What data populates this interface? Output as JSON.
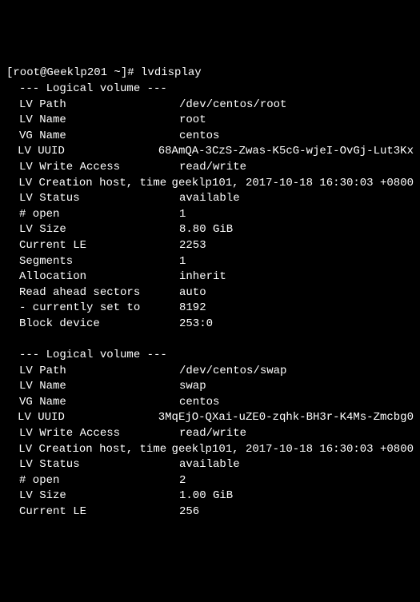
{
  "prompt": {
    "user_host": "[root@Geeklp201 ~]#",
    "command": "lvdisplay"
  },
  "volumes": [
    {
      "header": "--- Logical volume ---",
      "fields": [
        {
          "label": "LV Path",
          "value": "/dev/centos/root"
        },
        {
          "label": "LV Name",
          "value": "root"
        },
        {
          "label": "VG Name",
          "value": "centos"
        },
        {
          "label": "LV UUID",
          "value": "68AmQA-3CzS-Zwas-K5cG-wjeI-OvGj-Lut3Kx"
        },
        {
          "label": "LV Write Access",
          "value": "read/write"
        },
        {
          "label": "LV Creation host, time",
          "value": "geeklp101, 2017-10-18 16:30:03 +0800"
        },
        {
          "label": "LV Status",
          "value": "available"
        },
        {
          "label": "# open",
          "value": "1"
        },
        {
          "label": "LV Size",
          "value": "8.80 GiB"
        },
        {
          "label": "Current LE",
          "value": "2253"
        },
        {
          "label": "Segments",
          "value": "1"
        },
        {
          "label": "Allocation",
          "value": "inherit"
        },
        {
          "label": "Read ahead sectors",
          "value": "auto"
        },
        {
          "label": "- currently set to",
          "value": "8192"
        },
        {
          "label": "Block device",
          "value": "253:0"
        }
      ]
    },
    {
      "header": "--- Logical volume ---",
      "fields": [
        {
          "label": "LV Path",
          "value": "/dev/centos/swap"
        },
        {
          "label": "LV Name",
          "value": "swap"
        },
        {
          "label": "VG Name",
          "value": "centos"
        },
        {
          "label": "LV UUID",
          "value": "3MqEjO-QXai-uZE0-zqhk-BH3r-K4Ms-Zmcbg0"
        },
        {
          "label": "LV Write Access",
          "value": "read/write"
        },
        {
          "label": "LV Creation host, time",
          "value": "geeklp101, 2017-10-18 16:30:03 +0800"
        },
        {
          "label": "LV Status",
          "value": "available"
        },
        {
          "label": "# open",
          "value": "2"
        },
        {
          "label": "LV Size",
          "value": "1.00 GiB"
        },
        {
          "label": "Current LE",
          "value": "256"
        }
      ]
    }
  ]
}
